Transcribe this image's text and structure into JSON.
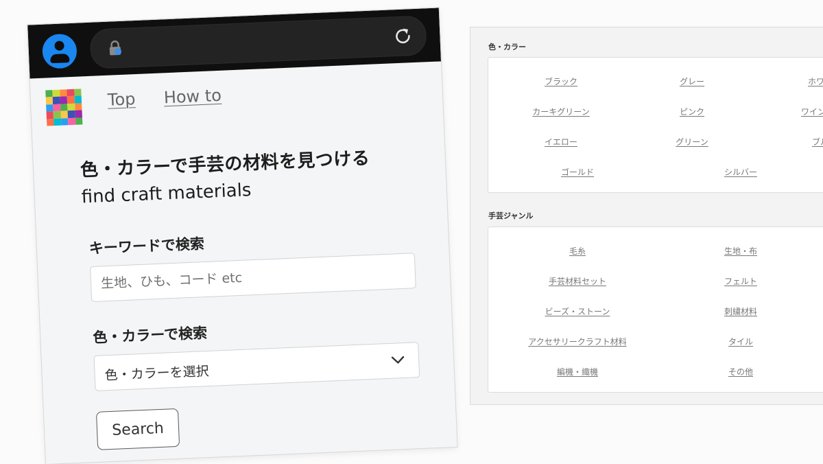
{
  "phone": {
    "nav": {
      "top": "Top",
      "howto": "How to"
    },
    "heading_jp": "色・カラーで手芸の材料を見つける",
    "heading_en": "find craft materials",
    "keyword": {
      "label": "キーワードで検索",
      "placeholder": "生地、ひも、コード etc"
    },
    "color": {
      "label": "色・カラーで検索",
      "selected": "色・カラーを選択"
    },
    "search_button": "Search",
    "icons": {
      "avatar": "person-icon",
      "lock": "lock-icon",
      "reload": "reload-icon",
      "dropdown": "chevron-down-icon"
    }
  },
  "panel": {
    "colors": {
      "title": "色・カラー",
      "items": [
        "ブラック",
        "グレー",
        "ホワ",
        "カーキグリーン",
        "ピンク",
        "ワイン",
        "イエロー",
        "グリーン",
        "ブル",
        "ゴールド",
        "シルバー"
      ]
    },
    "genres": {
      "title": "手芸ジャンル",
      "items": [
        "毛糸",
        "生地・布",
        "手芸材料セット",
        "フェルト",
        "ビーズ・ストーン",
        "刺繍材料",
        "アクセサリークラフト材料",
        "タイル",
        "編機・織機",
        "その他"
      ]
    }
  },
  "accents": {
    "browser_bar": "#0f0f0f",
    "avatar_blue": "#1a86ef",
    "panel_bg": "#f3f3f3"
  }
}
